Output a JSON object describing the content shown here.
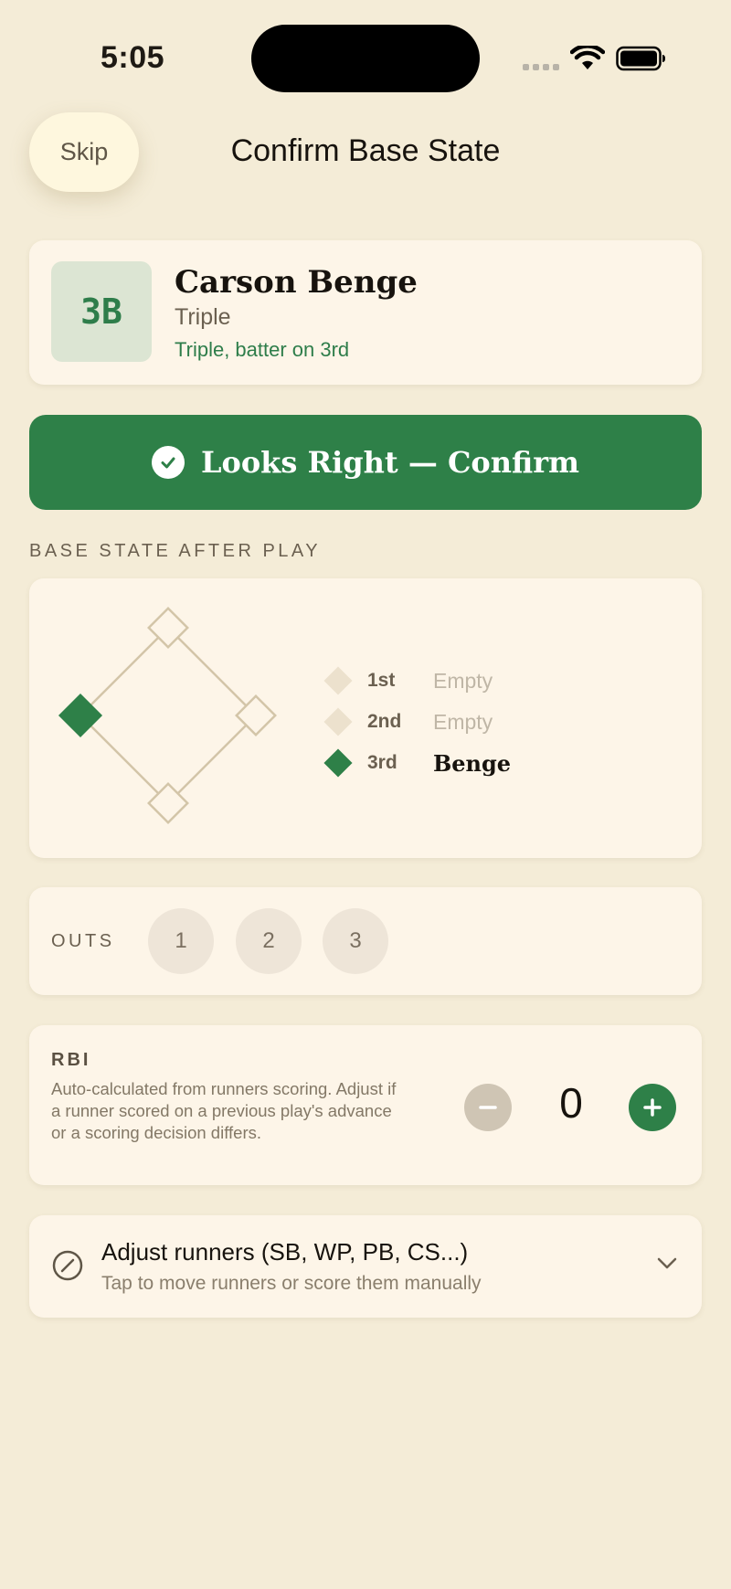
{
  "status_bar": {
    "time": "5:05"
  },
  "header": {
    "skip_label": "Skip",
    "title": "Confirm Base State"
  },
  "play": {
    "badge": "3B",
    "player": "Carson Benge",
    "type": "Triple",
    "description": "Triple, batter on 3rd"
  },
  "confirm": {
    "label": "Looks Right — Confirm"
  },
  "bases_section": {
    "label": "BASE STATE AFTER PLAY",
    "bases": [
      {
        "name": "1st",
        "occupant": "Empty",
        "occupied": false
      },
      {
        "name": "2nd",
        "occupant": "Empty",
        "occupied": false
      },
      {
        "name": "3rd",
        "occupant": "Benge",
        "occupied": true
      }
    ]
  },
  "outs": {
    "label": "OUTS",
    "options": [
      "1",
      "2",
      "3"
    ]
  },
  "rbi": {
    "label": "RBI",
    "help": "Auto-calculated from runners scoring. Adjust if a runner scored on a previous play's advance or a scoring decision differs.",
    "value": "0"
  },
  "adjust": {
    "title": "Adjust runners (SB, WP, PB, CS...)",
    "subtitle": "Tap to move runners or score them manually"
  },
  "colors": {
    "background": "#F4ECD7",
    "card": "#FDF5E8",
    "accent_green": "#2E8048",
    "text_dark": "#17130E",
    "text_muted": "#6B6050"
  }
}
